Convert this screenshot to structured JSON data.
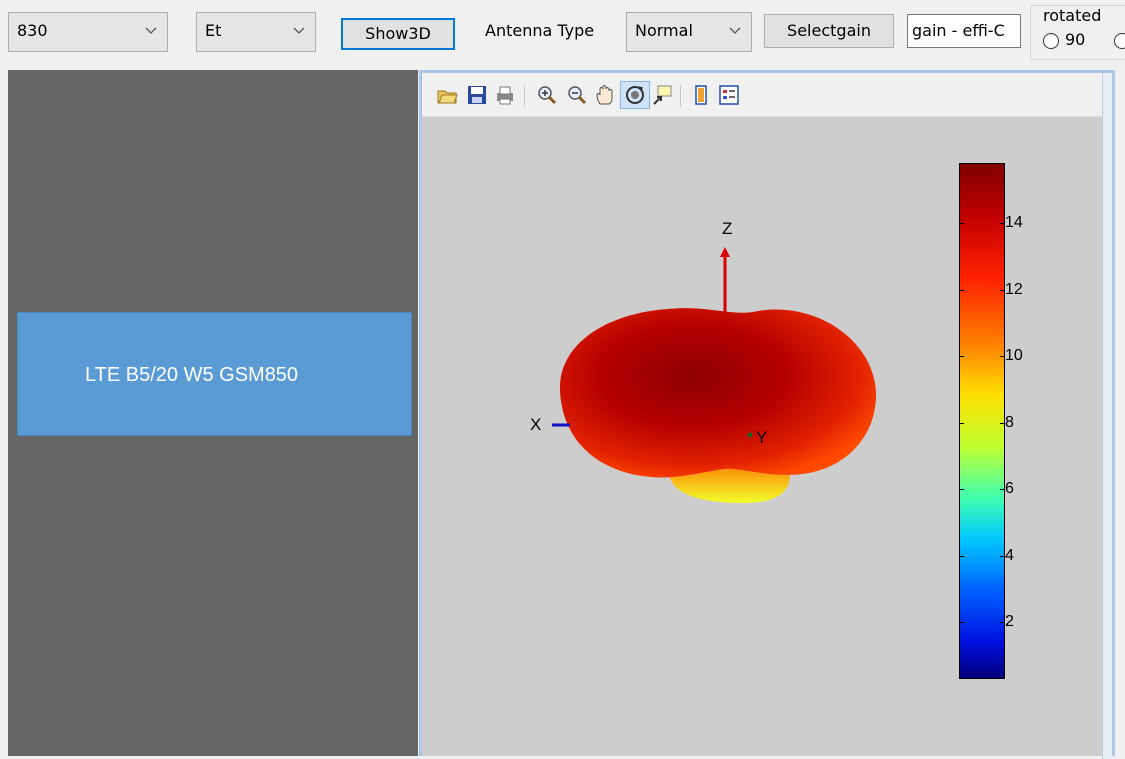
{
  "toolbar": {
    "frequency_value": "830",
    "field_value": "Et",
    "show3d_label": "Show3D",
    "antenna_type_label": "Antenna Type",
    "antenna_type_value": "Normal",
    "select_gain_label": "Selectgain",
    "gain_field_value": "gain - effi-C",
    "rotated_label": "rotated",
    "radio_90_label": "90"
  },
  "left_panel": {
    "band_label": "LTE B5/20 W5 GSM850"
  },
  "plot": {
    "axis_z": "Z",
    "axis_x": "X",
    "axis_y": "Y",
    "colorbar_ticks": [
      "14",
      "12",
      "10",
      "8",
      "6",
      "4",
      "2"
    ],
    "colorbar_values": [
      14,
      12,
      10,
      8,
      6,
      4,
      2
    ],
    "colorbar_range": [
      0.3,
      15.8
    ]
  },
  "figure_toolbar_icons": [
    "open-icon",
    "save-icon",
    "print-icon",
    "zoom-in-icon",
    "zoom-out-icon",
    "pan-icon",
    "rotate-3d-icon",
    "data-cursor-icon",
    "colorbar-icon",
    "legend-icon"
  ],
  "colors": {
    "panel_gray": "#666666",
    "band_box": "#5b9bd5",
    "plot_bg": "#cdcdcd",
    "frame_border": "#a9c7e8"
  }
}
